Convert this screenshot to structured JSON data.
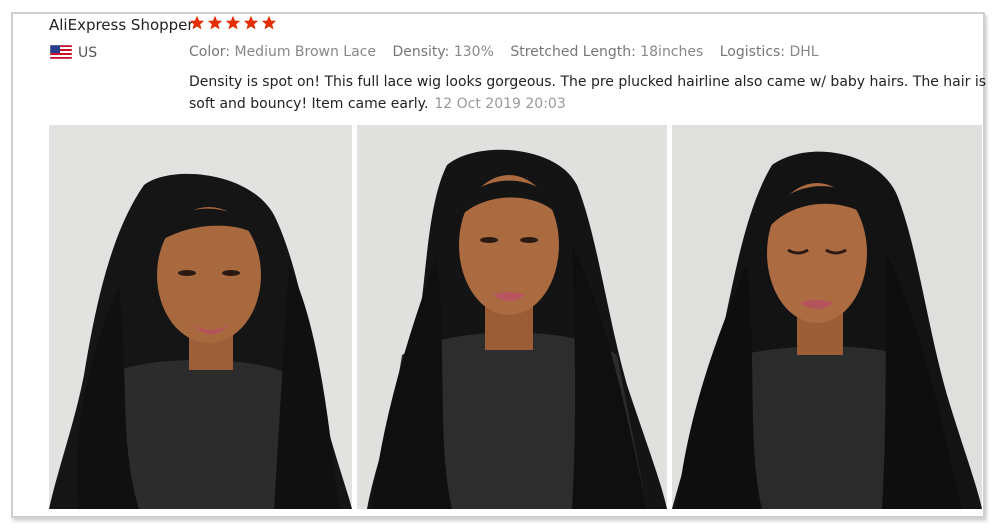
{
  "review": {
    "reviewer_name": "AliExpress Shopper",
    "rating": 5,
    "country": "US",
    "attributes": [
      {
        "label": "Color:",
        "value": "Medium Brown Lace"
      },
      {
        "label": "Density:",
        "value": "130%"
      },
      {
        "label": "Stretched Length:",
        "value": "18inches"
      },
      {
        "label": "Logistics:",
        "value": "DHL"
      }
    ],
    "text": "Density is spot on! This full lace wig looks gorgeous. The pre plucked hairline also came w/ baby hairs. The hair is soft and bouncy! Item came early.",
    "date": "12 Oct 2019 20:03",
    "photos": [
      "photo-1",
      "photo-2",
      "photo-3"
    ]
  },
  "colors": {
    "star": "#e62e04",
    "hair": "#141414",
    "skin": "#a8683f",
    "cape": "#2b2b2b",
    "background": "#dededc"
  }
}
